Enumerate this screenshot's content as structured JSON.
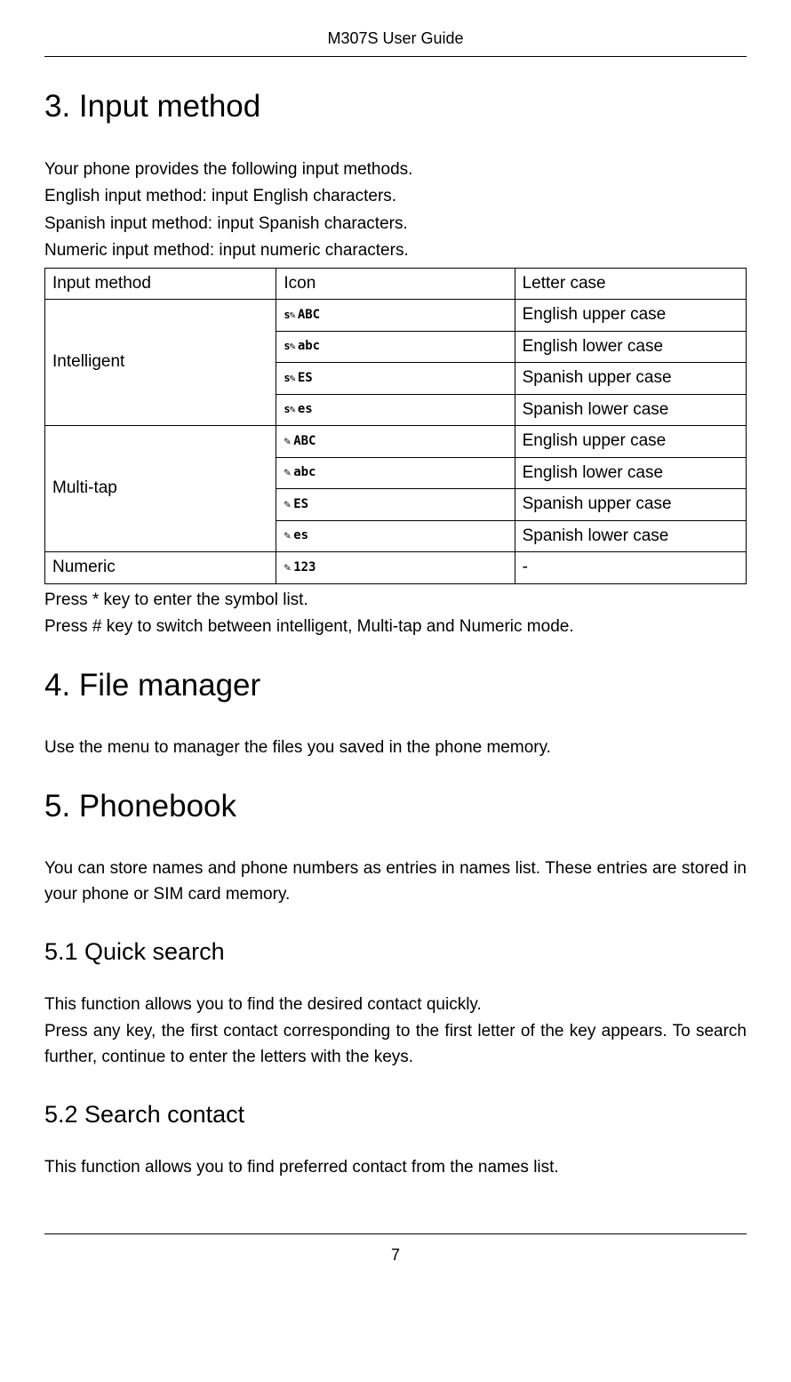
{
  "header": {
    "title": "M307S User Guide"
  },
  "section3": {
    "heading": "3. Input method",
    "intro1": "Your phone provides the following input methods.",
    "intro2": "English input method: input English characters.",
    "intro3": "Spanish input method: input Spanish characters.",
    "intro4": "Numeric input method: input numeric characters.",
    "table": {
      "header": {
        "c1": "Input method",
        "c2": "Icon",
        "c3": "Letter case"
      },
      "rows": [
        {
          "method": "Intelligent",
          "icon": "ABC",
          "iconClass": "s-pencil",
          "case": "English upper case",
          "rowspan": 4
        },
        {
          "icon": "abc",
          "iconClass": "s-pencil",
          "case": "English lower case"
        },
        {
          "icon": "ES",
          "iconClass": "s-pencil",
          "case": "Spanish upper case"
        },
        {
          "icon": "es",
          "iconClass": "s-pencil",
          "case": "Spanish lower case"
        },
        {
          "method": "Multi-tap",
          "icon": "ABC",
          "iconClass": "pencil",
          "case": "English upper case",
          "rowspan": 4
        },
        {
          "icon": "abc",
          "iconClass": "pencil",
          "case": "English lower case"
        },
        {
          "icon": "ES",
          "iconClass": "pencil",
          "case": "Spanish upper case"
        },
        {
          "icon": "es",
          "iconClass": "pencil",
          "case": "Spanish lower case"
        },
        {
          "method": "Numeric",
          "icon": "123",
          "iconClass": "pencil",
          "case": "-",
          "rowspan": 1
        }
      ]
    },
    "after1": "Press * key to enter the symbol list.",
    "after2": "Press # key to switch between intelligent, Multi-tap and Numeric mode."
  },
  "section4": {
    "heading": "4. File manager",
    "body": "Use the menu to manager the files you saved in the phone memory."
  },
  "section5": {
    "heading": "5. Phonebook",
    "body": "You can store names and phone numbers as entries in names list. These entries are stored in your phone or SIM card memory.",
    "sub1": {
      "heading": "5.1 Quick search",
      "p1": "This function allows you to find the desired contact quickly.",
      "p2": "Press any key, the first contact corresponding to the first letter of the key appears. To search further, continue to enter the letters with the keys."
    },
    "sub2": {
      "heading": "5.2 Search contact",
      "p1": "This function allows you to find preferred contact from the names list."
    }
  },
  "footer": {
    "page": "7"
  }
}
